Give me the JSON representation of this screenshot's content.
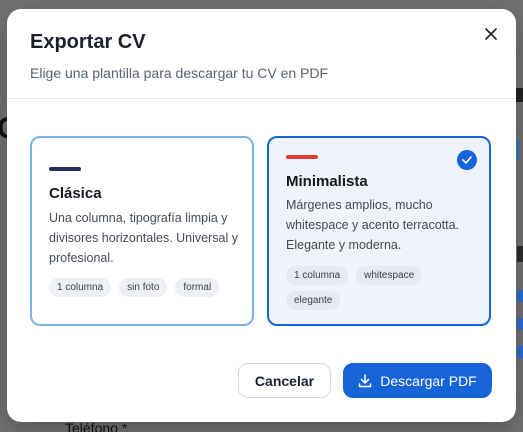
{
  "background": {
    "field_label": "Teléfono *"
  },
  "modal": {
    "title": "Exportar CV",
    "subtitle": "Elige una plantilla para descargar tu CV en PDF",
    "close_icon": "close-icon"
  },
  "templates": [
    {
      "name": "Clásica",
      "description": "Una columna, tipografía limpia y divisores horizontales. Universal y profesional.",
      "tags": [
        "1 columna",
        "sin foto",
        "formal"
      ],
      "accent_color": "#252c5c",
      "selected": false
    },
    {
      "name": "Minimalista",
      "description": "Márgenes amplios, mucho whitespace y acento terracotta. Elegante y moderna.",
      "tags": [
        "1 columna",
        "whitespace",
        "elegante"
      ],
      "accent_color": "#e23c32",
      "selected": true
    }
  ],
  "actions": {
    "cancel_label": "Cancelar",
    "download_label": "Descargar PDF",
    "download_icon": "download-icon"
  },
  "colors": {
    "primary": "#1764d8",
    "selected_card_bg": "#eef3fd"
  }
}
